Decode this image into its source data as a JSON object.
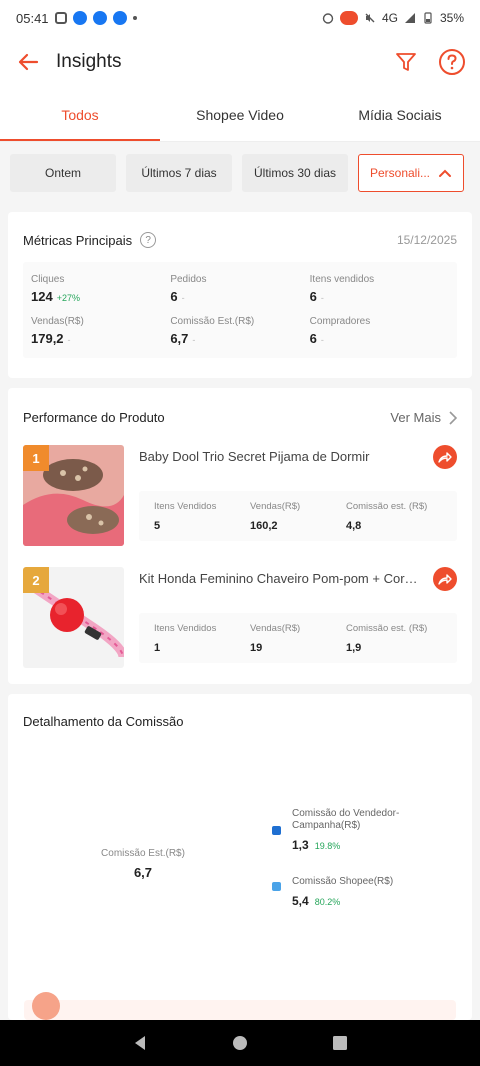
{
  "status_bar": {
    "time": "05:41",
    "network": "4G",
    "battery": "35%"
  },
  "header": {
    "title": "Insights",
    "back_icon": "arrow-left-icon",
    "filter_icon": "filter-icon",
    "help_icon": "help-circle-icon"
  },
  "tabs": [
    {
      "label": "Todos",
      "active": true
    },
    {
      "label": "Shopee Video",
      "active": false
    },
    {
      "label": "Mídia Sociais",
      "active": false
    }
  ],
  "filters": [
    {
      "label": "Ontem",
      "active": false
    },
    {
      "label": "Últimos 7 dias",
      "active": false
    },
    {
      "label": "Últimos 30 dias",
      "active": false
    },
    {
      "label": "Personali...",
      "active": true
    }
  ],
  "metrics": {
    "title": "Métricas Principais",
    "date": "15/12/2025",
    "items": [
      {
        "label": "Cliques",
        "value": "124",
        "change": "+27%"
      },
      {
        "label": "Pedidos",
        "value": "6",
        "change": "-"
      },
      {
        "label": "Itens vendidos",
        "value": "6",
        "change": "-"
      },
      {
        "label": "Vendas(R$)",
        "value": "179,2",
        "change": "-"
      },
      {
        "label": "Comissão Est.(R$)",
        "value": "6,7",
        "change": "-"
      },
      {
        "label": "Compradores",
        "value": "6",
        "change": "-"
      }
    ]
  },
  "performance": {
    "title": "Performance do Produto",
    "see_more": "Ver Mais",
    "products": [
      {
        "rank": "1",
        "name": "Baby Dool Trio Secret Pijama de Dormir",
        "stats": [
          {
            "label": "Itens Vendidos",
            "value": "5"
          },
          {
            "label": "Vendas(R$)",
            "value": "160,2"
          },
          {
            "label": "Comissão est. (R$)",
            "value": "4,8"
          }
        ]
      },
      {
        "rank": "2",
        "name": "Kit Honda Feminino Chaveiro Pom-pom + Cordão",
        "stats": [
          {
            "label": "Itens Vendidos",
            "value": "1"
          },
          {
            "label": "Vendas(R$)",
            "value": "19"
          },
          {
            "label": "Comissão est. (R$)",
            "value": "1,9"
          }
        ]
      }
    ]
  },
  "commission": {
    "title": "Detalhamento da Comissão",
    "center_label": "Comissão Est.(R$)",
    "center_value": "6,7",
    "legend": [
      {
        "label": "Comissão do Vendedor-Campanha(R$)",
        "value": "1,3",
        "pct": "19.8%",
        "color": "#1f6fd1"
      },
      {
        "label": "Comissão Shopee(R$)",
        "value": "5,4",
        "pct": "80.2%",
        "color": "#4aa3e8"
      }
    ]
  },
  "colors": {
    "accent": "#ee4d2d",
    "positive": "#26a65b"
  }
}
